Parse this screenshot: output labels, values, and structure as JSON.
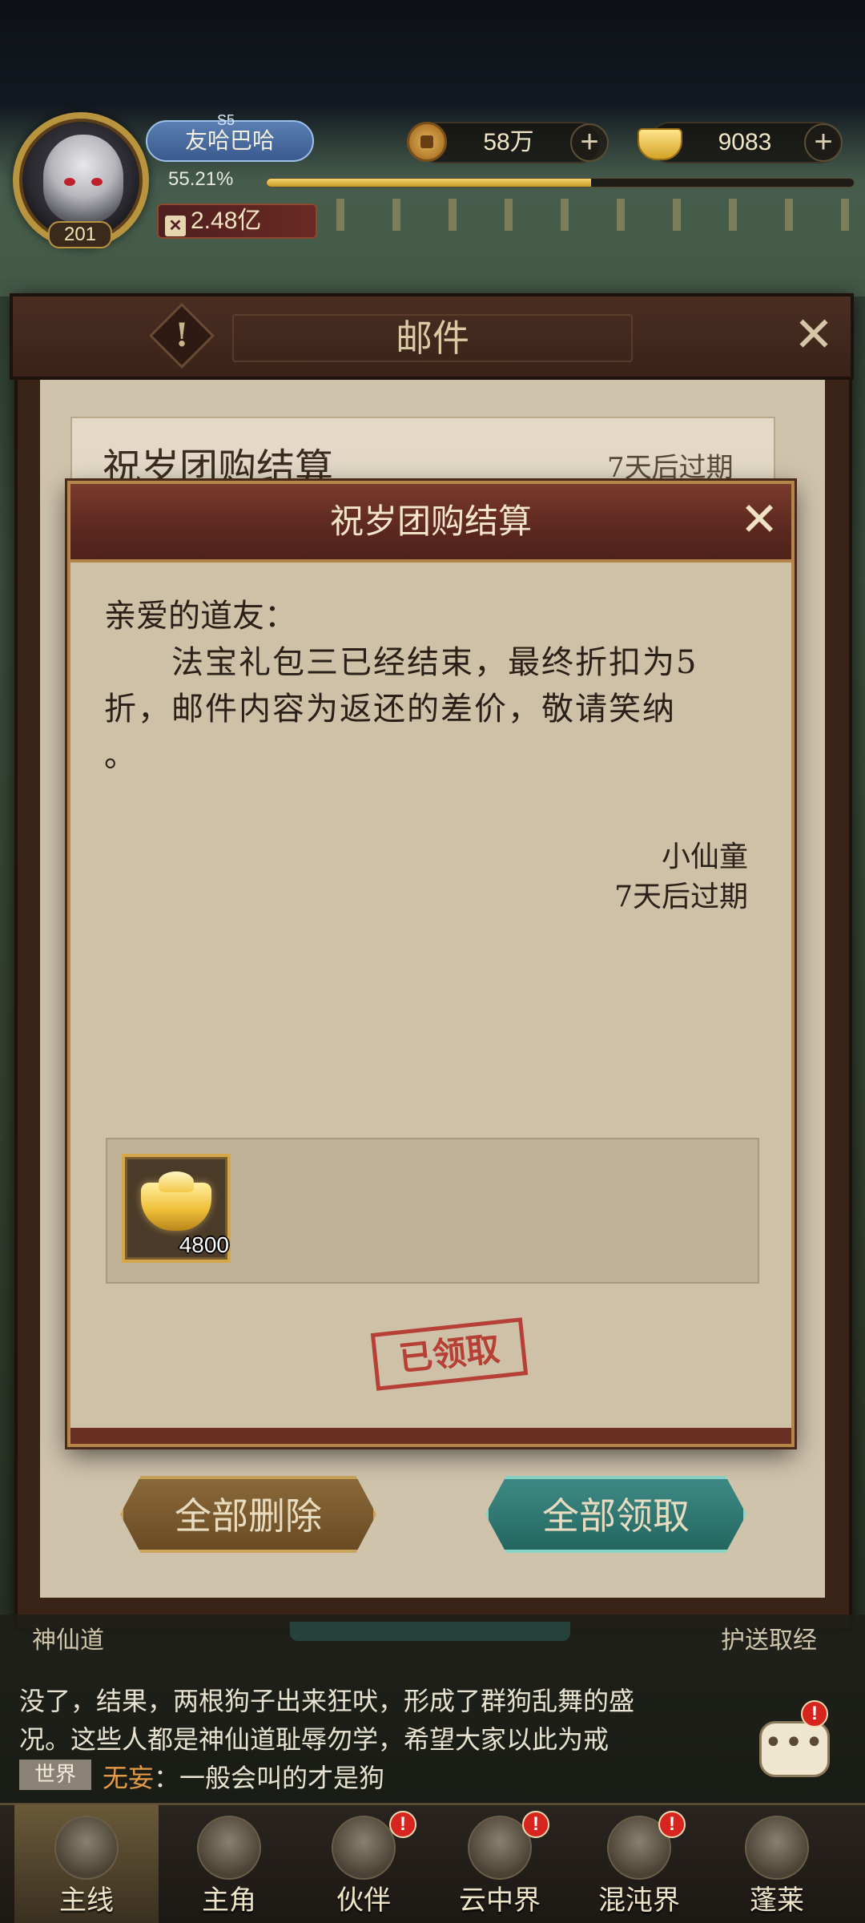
{
  "hud": {
    "player_name": "友哈巴哈",
    "vip": "S5",
    "level": "201",
    "exp_percent_text": "55.21%",
    "exp_fraction": 0.5521,
    "power": "2.48亿",
    "coins": "58万",
    "ingots": "9083",
    "plus": "+"
  },
  "mail_window": {
    "title": "邮件",
    "info_icon_text": "!",
    "close_symbol": "✕",
    "list_item": {
      "title": "祝岁团购结算",
      "expire": "7天后过期"
    },
    "delete_all_label": "全部删除",
    "claim_all_label": "全部领取"
  },
  "dialog": {
    "title": "祝岁团购结算",
    "close_symbol": "✕",
    "greeting": "亲爱的道友：",
    "body_lines": [
      "　　法宝礼包三已经结束，最终折扣为5",
      "折，邮件内容为返还的差价，敬请笑纳",
      "。"
    ],
    "sender": "小仙童",
    "expire": "7天后过期",
    "attachment": {
      "icon": "gold-ingot-icon",
      "count": "4800"
    },
    "claimed_stamp": "已领取"
  },
  "chat": {
    "cut_left": "神仙道",
    "cut_right": "护送取经",
    "lines": [
      "没了，结果，两根狗子出来狂吠，形成了群狗乱舞的盛",
      "况。这些人都是神仙道耻辱勿学，希望大家以此为戒"
    ],
    "channel": "世界",
    "user": "无妄",
    "message": "：一般会叫的才是狗",
    "bubble_dots": "•••",
    "badge": "!"
  },
  "nav": {
    "items": [
      {
        "label": "主线",
        "icon": "crossed-swords-icon",
        "badge": ""
      },
      {
        "label": "主角",
        "icon": "hero-portrait-icon",
        "badge": ""
      },
      {
        "label": "伙伴",
        "icon": "companion-icon",
        "badge": "!"
      },
      {
        "label": "云中界",
        "icon": "cloud-palace-icon",
        "badge": "!"
      },
      {
        "label": "混沌界",
        "icon": "chaos-realm-icon",
        "badge": "!"
      },
      {
        "label": "蓬莱",
        "icon": "penglai-icon",
        "badge": ""
      }
    ]
  },
  "colors": {
    "dialog_header": "#5c2820",
    "dialog_body": "#cec1a8",
    "stamp_red": "#b4322a",
    "gold_border": "#d4a64a",
    "chat_user": "#e49a46"
  }
}
